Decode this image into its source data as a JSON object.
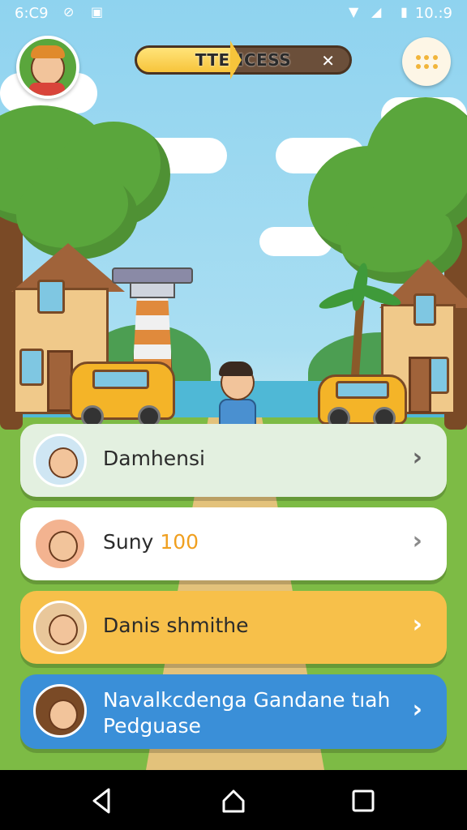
{
  "status_bar": {
    "time": "6:C9",
    "battery_time": "10.:9",
    "icons": [
      "vpn-icon",
      "shield-icon",
      "calendar-icon",
      "wifi-icon",
      "signal-icon",
      "battery-icon"
    ]
  },
  "header": {
    "progress_label": "TTENCESS",
    "progress_fraction": 0.46,
    "progress_end_icon": "close-icon",
    "menu_icon": "grid-dots-icon",
    "profile_icon": "player-avatar"
  },
  "list": [
    {
      "name": "Damhensi",
      "score": "",
      "bg": "#e3f0e0",
      "chevron_color": "#666666"
    },
    {
      "name": "Suny ",
      "score": "100",
      "bg": "#ffffff",
      "chevron_color": "#8a8a8a"
    },
    {
      "name": "Danis shmithe",
      "score": "",
      "bg": "#f7c04a",
      "chevron_color": "#ffffff"
    },
    {
      "name_line1": "Navalkcdenga Gandane tıah",
      "name_line2": "Pedguase",
      "bg": "#3a8fd8",
      "chevron_color": "#ffffff"
    }
  ],
  "colors": {
    "accent_yellow": "#f7c43b",
    "progress_track": "#6b4f3a",
    "blue_card": "#3a8fd8"
  },
  "navbar": {
    "icons": [
      "back-icon",
      "home-icon",
      "recents-icon"
    ]
  }
}
